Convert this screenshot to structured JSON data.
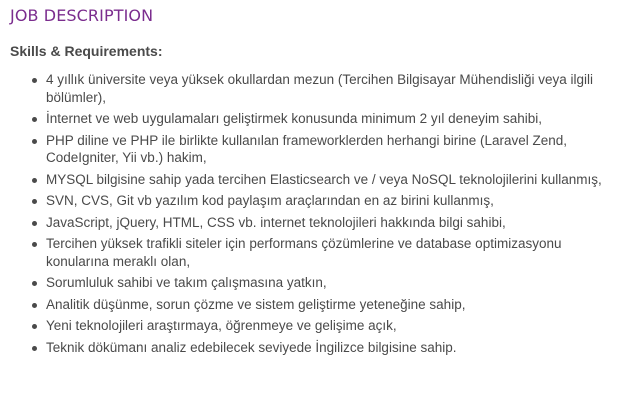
{
  "section": {
    "title": "JOB DESCRIPTION",
    "subtitle": "Skills & Requirements:",
    "items": [
      "4 yıllık üniversite veya yüksek okullardan mezun (Tercihen Bilgisayar Mühendisliği veya ilgili bölümler),",
      "İnternet ve web uygulamaları geliştirmek konusunda minimum 2 yıl deneyim sahibi,",
      "PHP diline ve PHP ile birlikte kullanılan frameworklerden herhangi birine (Laravel Zend, CodeIgniter, Yii vb.) hakim,",
      "MYSQL bilgisine sahip yada tercihen Elasticsearch ve / veya NoSQL teknolojilerini kullanmış,",
      "SVN, CVS, Git vb yazılım kod paylaşım araçlarından en az birini kullanmış,",
      "JavaScript, jQuery, HTML, CSS vb. internet teknolojileri hakkında bilgi sahibi,",
      "Tercihen yüksek trafikli siteler için performans çözümlerine ve database optimizasyonu konularına meraklı olan,",
      "Sorumluluk sahibi ve takım çalışmasına yatkın,",
      "Analitik düşünme, sorun çözme ve sistem geliştirme yeteneğine sahip,",
      "Yeni teknolojileri araştırmaya, öğrenmeye ve gelişime açık,",
      "Teknik dökümanı analiz edebilecek seviyede İngilizce bilgisine sahip."
    ]
  },
  "colors": {
    "title": "#7b2d8e",
    "text": "#4a4a4a",
    "background": "#ffffff"
  }
}
